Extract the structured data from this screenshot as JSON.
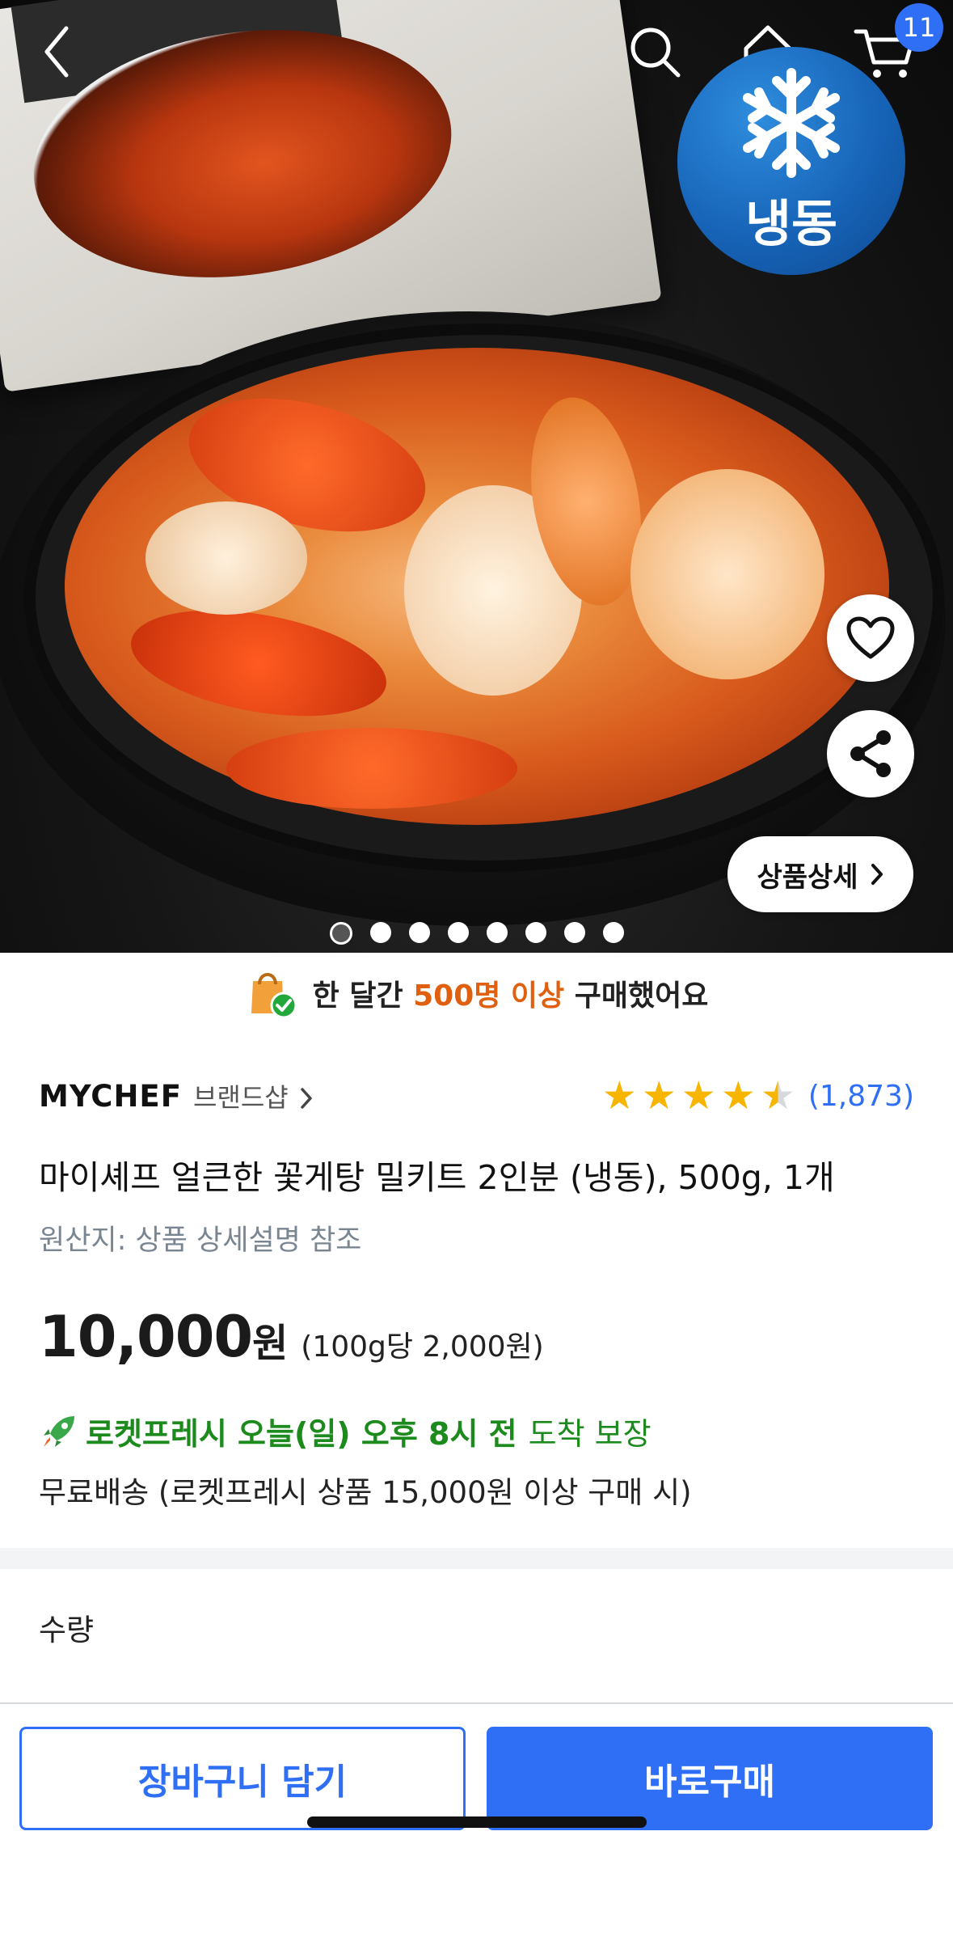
{
  "hero": {
    "frozen_label": "냉동",
    "detail_button_label": "상품상세",
    "image_count": 8,
    "active_image_index": 0,
    "cart_count": "11"
  },
  "purchase_banner": {
    "prefix": "한 달간",
    "highlight": "500명 이상",
    "suffix": "구매했어요"
  },
  "product": {
    "brand": "MYCHEF",
    "brand_shop_label": "브랜드샵",
    "rating": 4.5,
    "rating_count": "(1,873)",
    "title": "마이셰프 얼큰한 꽃게탕 밀키트 2인분 (냉동), 500g, 1개",
    "origin": "원산지: 상품 상세설명 참조",
    "price": "10,000",
    "price_unit": "원",
    "unit_price": "(100g당 2,000원)",
    "delivery_strong": "로켓프레시 오늘(일) 오후 8시 전",
    "delivery_normal": "도착 보장",
    "free_shipping": "무료배송 (로켓프레시 상품 15,000원 이상 구매 시)",
    "quantity_label": "수량"
  },
  "actions": {
    "add_to_cart": "장바구니 담기",
    "buy_now": "바로구매"
  },
  "colors": {
    "accent": "#2f6ff5",
    "highlight": "#e0600f",
    "delivery": "#1c8a1c",
    "star": "#f7b500"
  },
  "icons": [
    "back-icon",
    "search-icon",
    "home-icon",
    "cart-icon",
    "snowflake-icon",
    "heart-icon",
    "share-icon",
    "chevron-right-icon",
    "shopping-bag-check-icon",
    "star-icon",
    "rocket-icon"
  ]
}
